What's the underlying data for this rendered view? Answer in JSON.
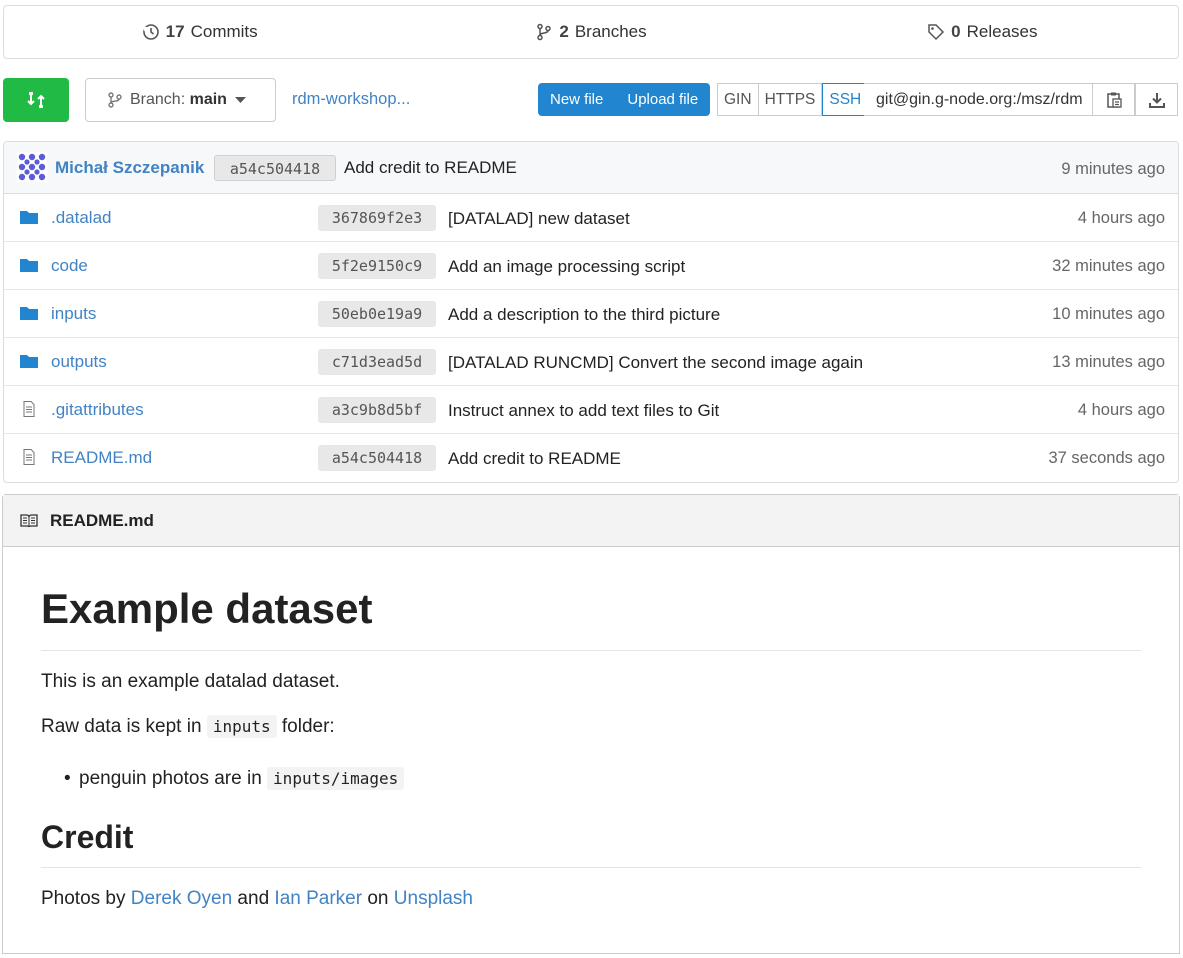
{
  "stats": {
    "commits_count": "17",
    "commits_label": "Commits",
    "branches_count": "2",
    "branches_label": "Branches",
    "releases_count": "0",
    "releases_label": "Releases"
  },
  "toolbar": {
    "branch_prefix": "Branch:",
    "branch_name": "main",
    "repo_link": "rdm-workshop...",
    "new_file": "New file",
    "upload_file": "Upload file",
    "protocols": [
      "GIN",
      "HTTPS",
      "SSH"
    ],
    "active_protocol": "SSH",
    "clone_url": "git@gin.g-node.org:/msz/rdm"
  },
  "latest_commit": {
    "author": "Michał Szczepanik",
    "sha": "a54c504418",
    "message": "Add credit to README",
    "age": "9 minutes ago"
  },
  "files": [
    {
      "name": ".datalad",
      "type": "folder",
      "sha": "367869f2e3",
      "message": "[DATALAD] new dataset",
      "age": "4 hours ago"
    },
    {
      "name": "code",
      "type": "folder",
      "sha": "5f2e9150c9",
      "message": "Add an image processing script",
      "age": "32 minutes ago"
    },
    {
      "name": "inputs",
      "type": "folder",
      "sha": "50eb0e19a9",
      "message": "Add a description to the third picture",
      "age": "10 minutes ago"
    },
    {
      "name": "outputs",
      "type": "folder",
      "sha": "c71d3ead5d",
      "message": "[DATALAD RUNCMD] Convert the second image again",
      "age": "13 minutes ago"
    },
    {
      "name": ".gitattributes",
      "type": "file",
      "sha": "a3c9b8d5bf",
      "message": "Instruct annex to add text files to Git",
      "age": "4 hours ago"
    },
    {
      "name": "README.md",
      "type": "file",
      "sha": "a54c504418",
      "message": "Add credit to README",
      "age": "37 seconds ago"
    }
  ],
  "readme": {
    "filename": "README.md",
    "h1": "Example dataset",
    "p1": "This is an example datalad dataset.",
    "p2_before": "Raw data is kept in ",
    "p2_code": "inputs",
    "p2_after": " folder:",
    "li1_before": "penguin photos are in ",
    "li1_code": "inputs/images",
    "h2": "Credit",
    "p3_before": "Photos by ",
    "p3_link1": "Derek Oyen",
    "p3_mid1": " and ",
    "p3_link2": "Ian Parker",
    "p3_mid2": " on ",
    "p3_link3": "Unsplash"
  },
  "colors": {
    "link": "#4183c4",
    "primary_button": "#2185d0",
    "compare_button": "#21ba45"
  }
}
